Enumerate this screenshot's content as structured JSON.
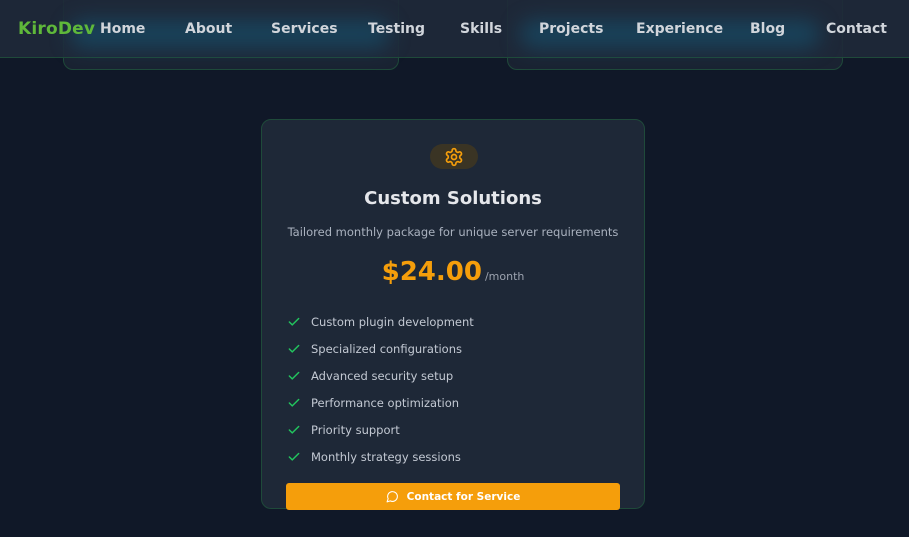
{
  "nav": {
    "brand": "KiroDev",
    "links": [
      "Home",
      "About",
      "Services",
      "Testing",
      "Skills",
      "Projects",
      "Experience",
      "Blog",
      "Contact"
    ]
  },
  "card": {
    "icon": "gear-icon",
    "title": "Custom Solutions",
    "description": "Tailored monthly package for unique server requirements",
    "price": "$24.00",
    "period": "/month",
    "features": [
      "Custom plugin development",
      "Specialized configurations",
      "Advanced security setup",
      "Performance optimization",
      "Priority support",
      "Monthly strategy sessions"
    ],
    "cta_icon": "message-circle-icon",
    "cta_label": "Contact for Service"
  },
  "colors": {
    "background": "#101828",
    "card": "#1e2837",
    "accent": "#f59e0b",
    "brand": "#5fb83a",
    "check": "#22c55e"
  }
}
